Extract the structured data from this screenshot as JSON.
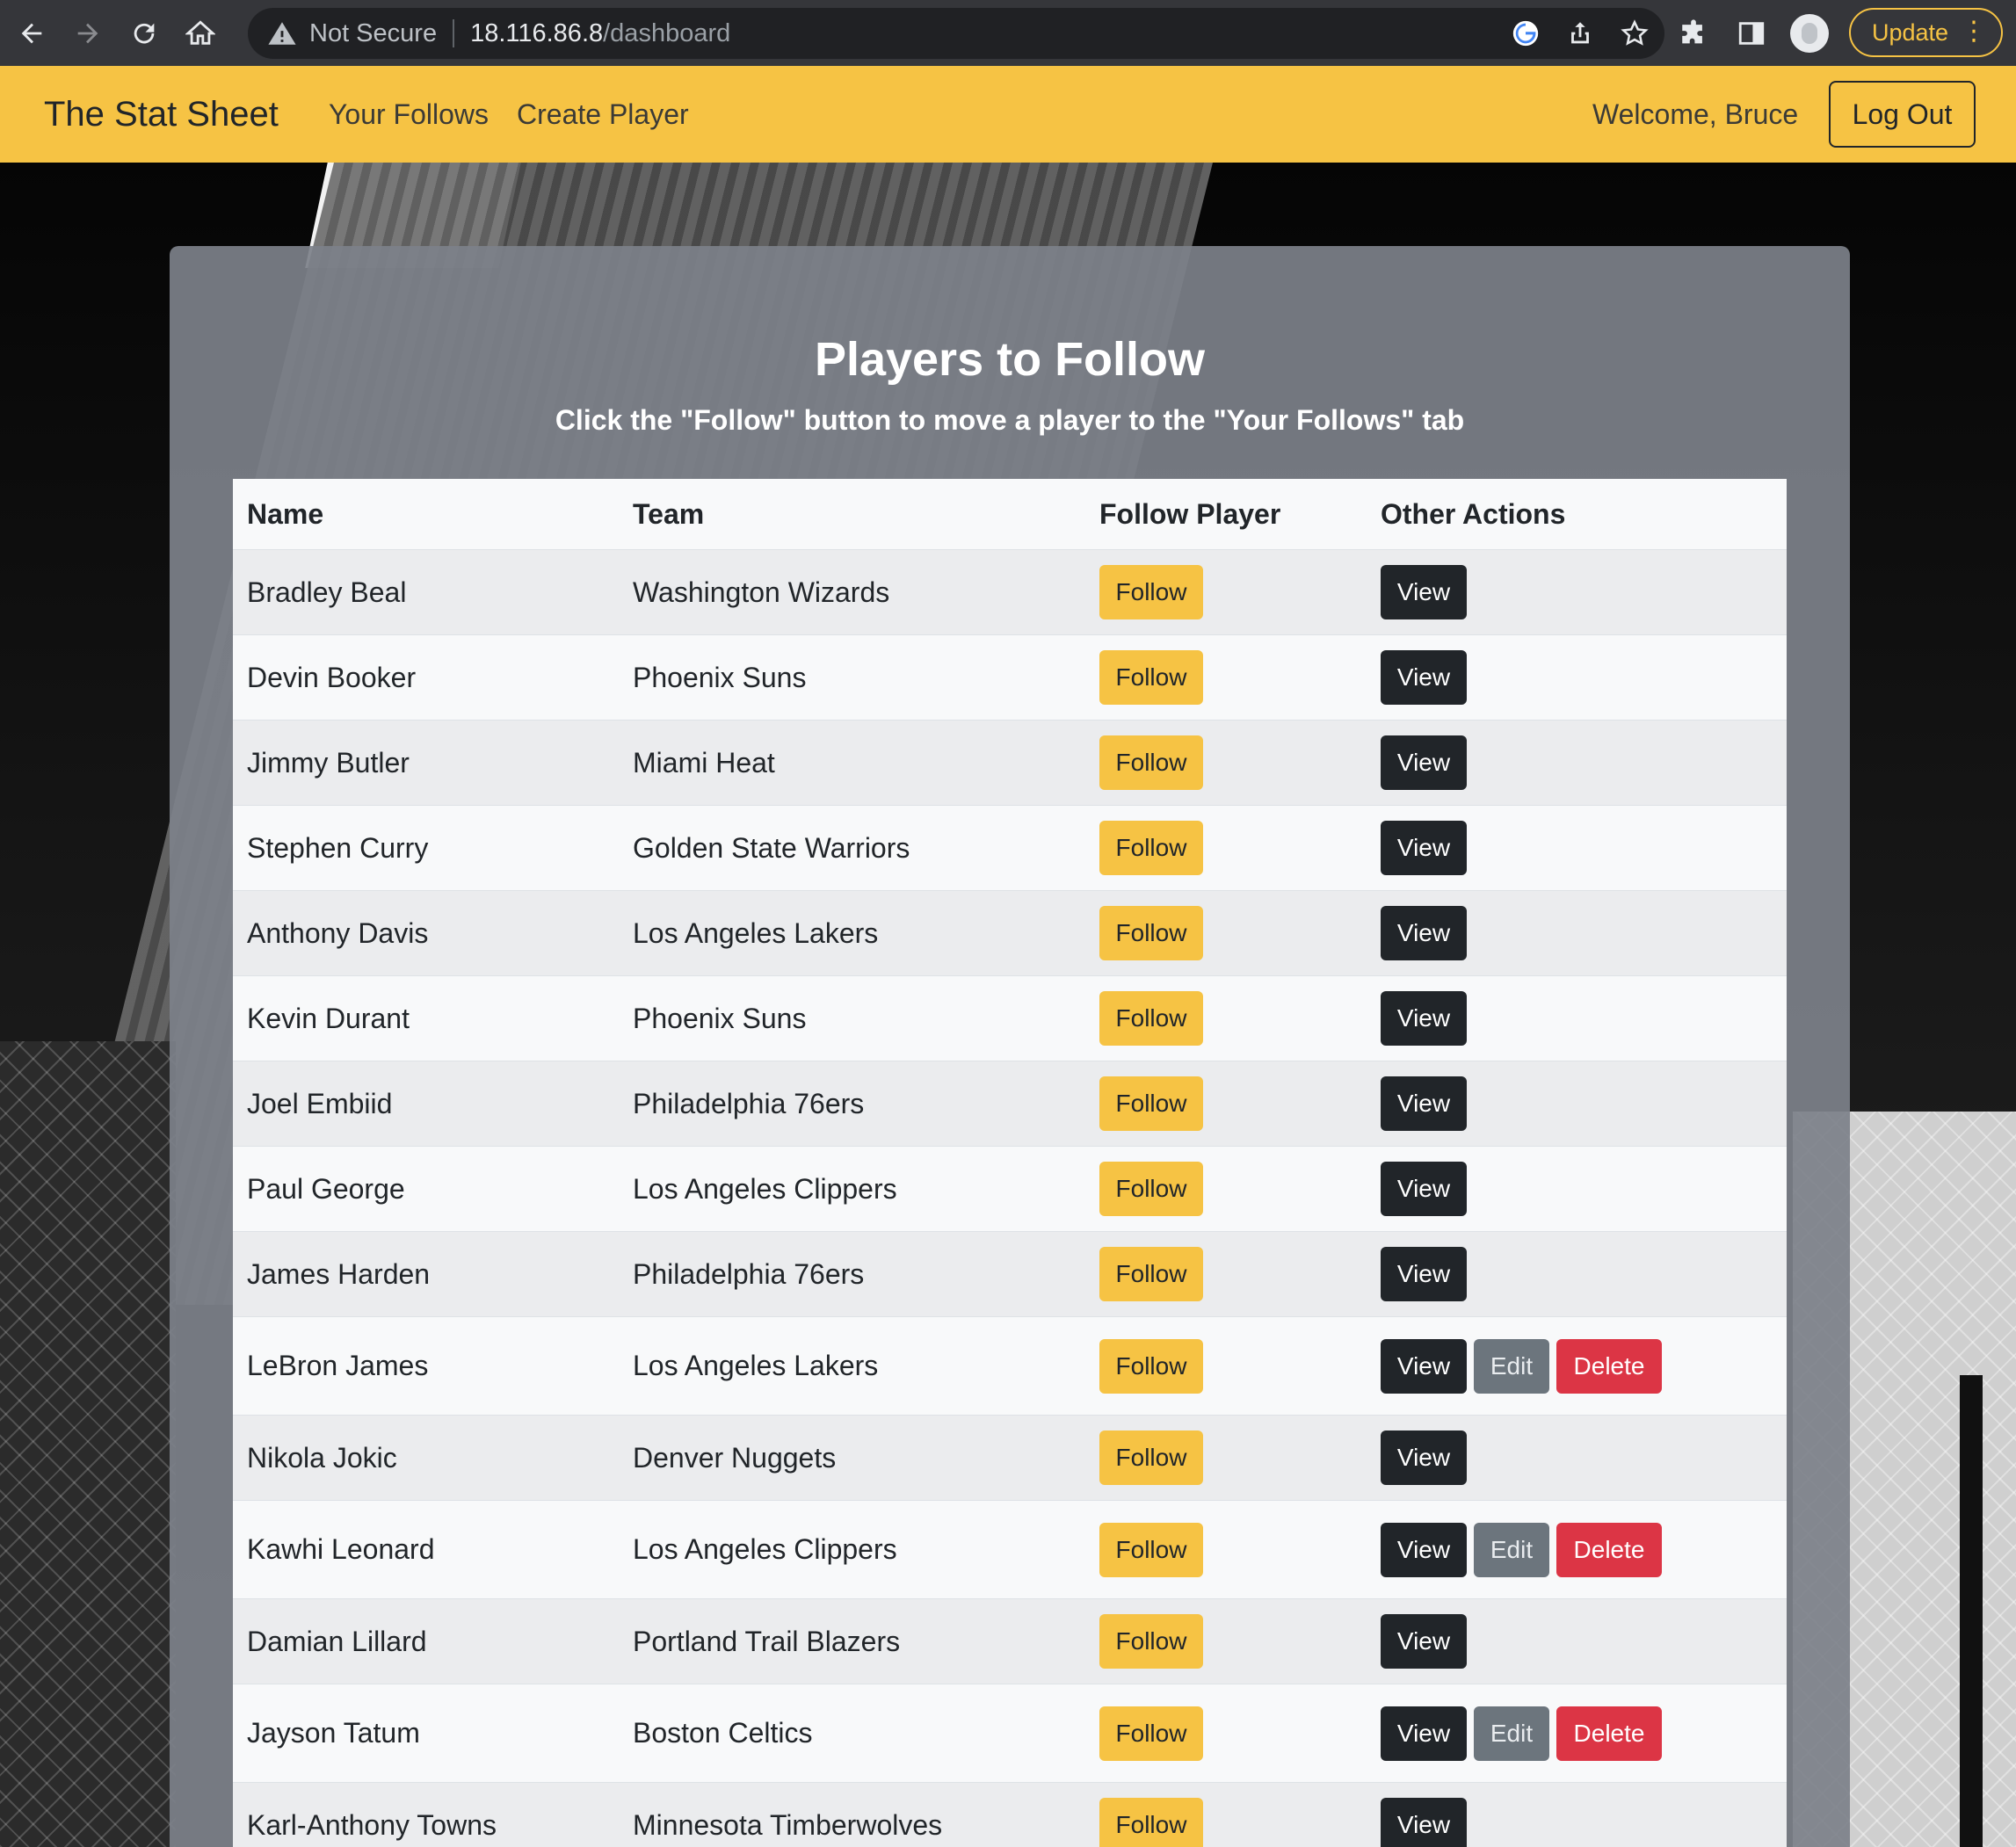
{
  "browser": {
    "security_label": "Not Secure",
    "url_host": "18.116.86.8",
    "url_path": "/dashboard",
    "update_label": "Update",
    "update_menu": "⋮"
  },
  "navbar": {
    "brand": "The Stat Sheet",
    "links": [
      "Your Follows",
      "Create Player"
    ],
    "welcome": "Welcome, Bruce",
    "logout": "Log Out"
  },
  "page": {
    "title": "Players to Follow",
    "subtitle": "Click the \"Follow\" button to move a player to the \"Your Follows\" tab"
  },
  "table": {
    "headers": [
      "Name",
      "Team",
      "Follow Player",
      "Other Actions"
    ],
    "follow_label": "Follow",
    "view_label": "View",
    "edit_label": "Edit",
    "delete_label": "Delete",
    "rows": [
      {
        "name": "Bradley Beal",
        "team": "Washington Wizards",
        "owned": false
      },
      {
        "name": "Devin Booker",
        "team": "Phoenix Suns",
        "owned": false
      },
      {
        "name": "Jimmy Butler",
        "team": "Miami Heat",
        "owned": false
      },
      {
        "name": "Stephen Curry",
        "team": "Golden State Warriors",
        "owned": false
      },
      {
        "name": "Anthony Davis",
        "team": "Los Angeles Lakers",
        "owned": false
      },
      {
        "name": "Kevin Durant",
        "team": "Phoenix Suns",
        "owned": false
      },
      {
        "name": "Joel Embiid",
        "team": "Philadelphia 76ers",
        "owned": false
      },
      {
        "name": "Paul George",
        "team": "Los Angeles Clippers",
        "owned": false
      },
      {
        "name": "James Harden",
        "team": "Philadelphia 76ers",
        "owned": false
      },
      {
        "name": "LeBron James",
        "team": "Los Angeles Lakers",
        "owned": true
      },
      {
        "name": "Nikola Jokic",
        "team": "Denver Nuggets",
        "owned": false
      },
      {
        "name": "Kawhi Leonard",
        "team": "Los Angeles Clippers",
        "owned": true
      },
      {
        "name": "Damian Lillard",
        "team": "Portland Trail Blazers",
        "owned": false
      },
      {
        "name": "Jayson Tatum",
        "team": "Boston Celtics",
        "owned": true
      },
      {
        "name": "Karl-Anthony Towns",
        "team": "Minnesota Timberwolves",
        "owned": false
      }
    ]
  },
  "icons": {
    "back": "arrow-left-icon",
    "forward": "arrow-right-icon",
    "reload": "reload-icon",
    "home": "home-icon",
    "warning": "warning-triangle-icon",
    "google": "google-icon",
    "share": "share-icon",
    "bookmark": "star-icon",
    "extensions": "puzzle-icon",
    "sidepanel": "side-panel-icon",
    "profile": "profile-avatar-icon"
  },
  "colors": {
    "accent": "#f6c344",
    "dark_button": "#212529",
    "secondary_button": "#6c757d",
    "danger_button": "#dc3545"
  }
}
